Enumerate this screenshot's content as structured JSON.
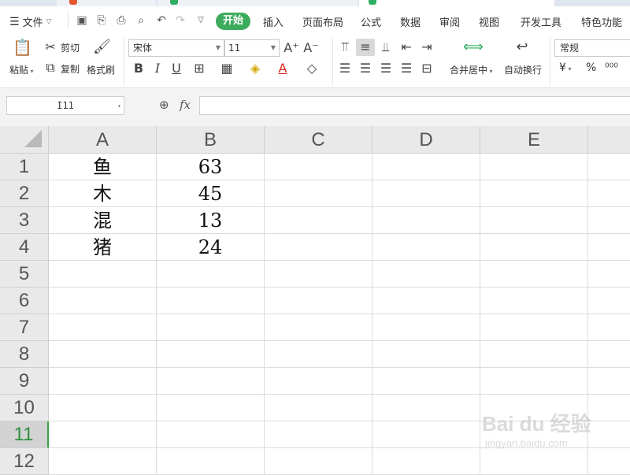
{
  "menu": {
    "file_label": "文件",
    "tabs": [
      "开始",
      "插入",
      "页面布局",
      "公式",
      "数据",
      "审阅",
      "视图",
      "开发工具",
      "特色功能"
    ]
  },
  "ribbon": {
    "paste": "粘贴",
    "cut": "剪切",
    "copy": "复制",
    "format_painter": "格式刷",
    "font_name": "宋体",
    "font_size": "11",
    "merge_center": "合并居中",
    "wrap_text": "自动换行",
    "number_format": "常规",
    "currency_symbol": "¥",
    "percent_symbol": "%"
  },
  "formula_bar": {
    "name_box": "I11",
    "fx": "fx",
    "formula": ""
  },
  "sheet": {
    "columns": [
      "A",
      "B",
      "C",
      "D",
      "E"
    ],
    "rows": [
      "1",
      "2",
      "3",
      "4",
      "5",
      "6",
      "7",
      "8",
      "9",
      "10",
      "11",
      "12"
    ],
    "selected_row": "11",
    "cells": [
      [
        "鱼",
        "63"
      ],
      [
        "木",
        "45"
      ],
      [
        "混",
        "13"
      ],
      [
        "猪",
        "24"
      ]
    ]
  },
  "watermark": {
    "brand": "Bai du 经验",
    "url": "jingyan.baidu.com"
  },
  "colors": {
    "accent_green": "#3dab5c",
    "selected_row_text": "#2f8f3f",
    "header_bg": "#e9e9e9"
  }
}
